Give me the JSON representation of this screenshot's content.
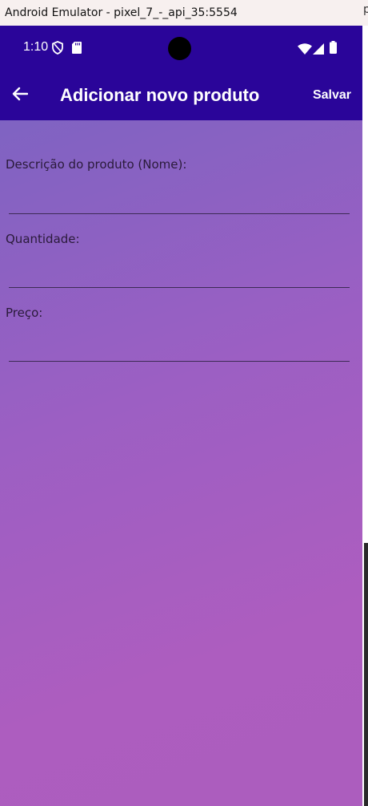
{
  "window": {
    "title": "Android Emulator - pixel_7_-_api_35:5554",
    "edge_char": "p"
  },
  "statusbar": {
    "time": "1:10",
    "icons": [
      "shield-icon",
      "sd-card-icon",
      "wifi-icon",
      "signal-icon",
      "battery-icon"
    ]
  },
  "appbar": {
    "back_icon": "arrow-left-icon",
    "title": "Adicionar novo produto",
    "save_label": "Salvar"
  },
  "form": {
    "name_label": "Descrição do produto (Nome):",
    "name_value": "",
    "quantity_label": "Quantidade:",
    "quantity_value": "",
    "price_label": "Preço:",
    "price_value": ""
  },
  "colors": {
    "toolbar": "#2a0599",
    "gradient_start": "#7f63c2",
    "gradient_end": "#ac5dbe"
  }
}
